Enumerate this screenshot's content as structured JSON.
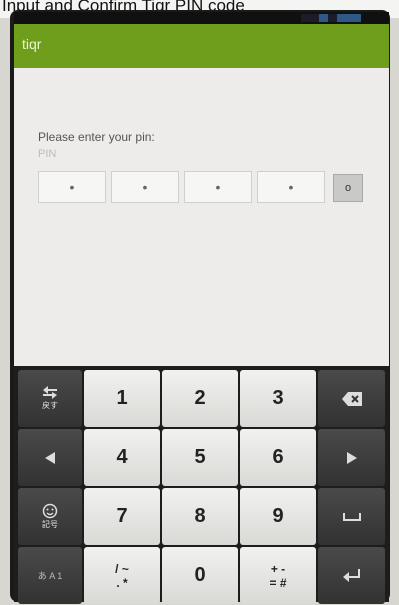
{
  "caption": "Input and Confirm Tiqr PIN code",
  "app": {
    "title": "tiqr"
  },
  "pin_form": {
    "prompt": "Please enter your pin:",
    "hint": "PIN",
    "digits": [
      "•",
      "•",
      "•",
      "•"
    ],
    "ok_label": "o"
  },
  "keyboard": {
    "keys": {
      "k1": "1",
      "k2": "2",
      "k3": "3",
      "k4": "4",
      "k5": "5",
      "k6": "6",
      "k7": "7",
      "k8": "8",
      "k9": "9",
      "k0": "0",
      "sym1": "/ ~",
      "sym1b": ". *",
      "sym2": "+ -",
      "sym2b": "= #",
      "undo_label": "戻す",
      "emoji_label": "記号",
      "mode_label": "あ A 1"
    }
  },
  "icons": [
    "undo-icon",
    "backspace-icon",
    "left-arrow-icon",
    "right-arrow-icon",
    "emoji-icon",
    "space-icon",
    "enter-icon"
  ]
}
